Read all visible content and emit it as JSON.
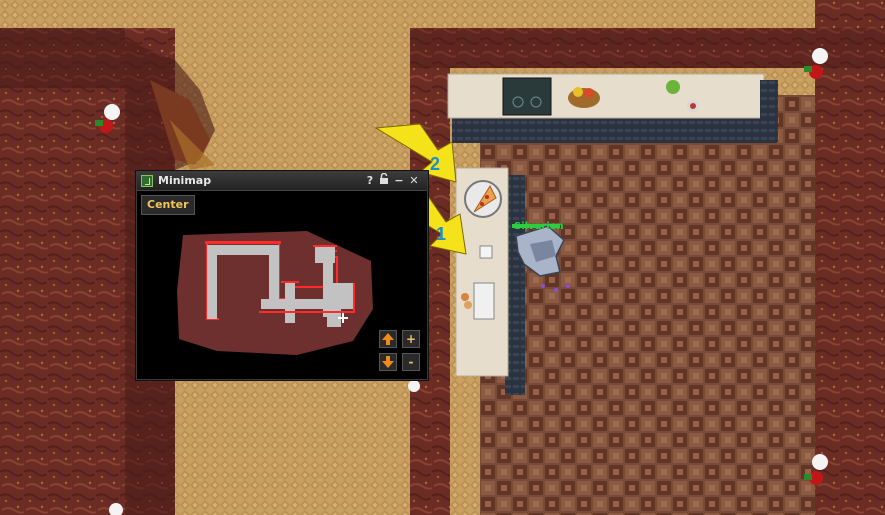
{
  "minimap": {
    "title": "Minimap",
    "help_label": "?",
    "minimize_label": "−",
    "close_label": "✕",
    "center_label": "Center",
    "zoom_in_label": "+",
    "zoom_out_label": "-"
  },
  "annotations": {
    "arrow_1": "1",
    "arrow_2": "2"
  },
  "player": {
    "name": "Silvarion"
  },
  "colors": {
    "sand": "#c9a061",
    "earth_wall": "#6b2c24",
    "tile_floor": "#7a4a35",
    "counter": "#e6ddcc",
    "arrow": "#f6e21b",
    "arrow_number": "#1a8fc8",
    "player_name": "#2ecc40",
    "minimap_room": "#6e2f2f",
    "minimap_path": "#c2c2c2",
    "minimap_wall": "#ff2a2a",
    "minimap_button_text": "#f0c85a"
  },
  "icons": {
    "lock": "lock-icon",
    "help": "help-icon",
    "close": "close-icon",
    "minimize": "minimize-icon",
    "up": "arrow-up-icon",
    "down": "arrow-down-icon"
  }
}
